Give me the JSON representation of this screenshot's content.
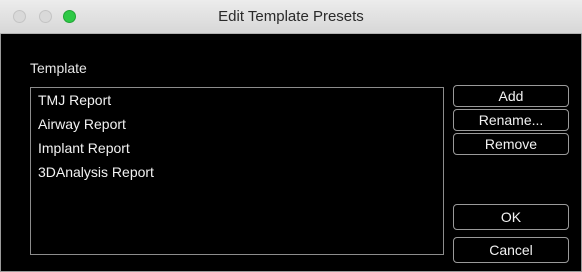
{
  "window": {
    "title": "Edit Template Presets"
  },
  "colors": {
    "background": "#000000",
    "text": "#f2f2f2",
    "titlebar": "#e3e3e3",
    "zoom_button": "#2ec946"
  },
  "template_section": {
    "label": "Template",
    "items": [
      "TMJ Report",
      "Airway Report",
      "Implant Report",
      "3DAnalysis Report"
    ]
  },
  "buttons": {
    "add": "Add",
    "rename": "Rename...",
    "remove": "Remove",
    "ok": "OK",
    "cancel": "Cancel"
  }
}
